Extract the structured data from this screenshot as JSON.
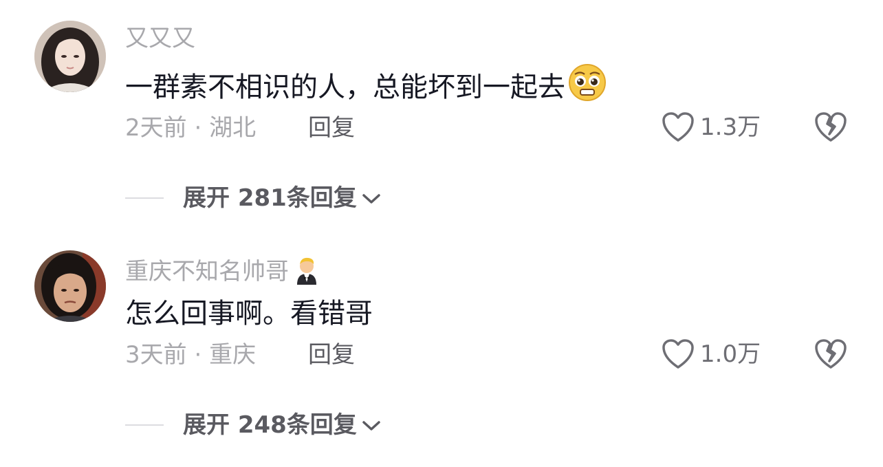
{
  "comments": [
    {
      "username": "又又又",
      "text": "一群素不相识的人，总能坏到一起去",
      "text_emoji": "pleading-face-emoji",
      "time": "2天前",
      "location": "湖北",
      "reply_label": "回复",
      "likes": "1.3万",
      "expand_label": "展开 281条回复"
    },
    {
      "username": "重庆不知名帅哥",
      "username_emoji": "man-in-tuxedo-emoji",
      "text": "怎么回事啊。看错哥",
      "time": "3天前",
      "location": "重庆",
      "reply_label": "回复",
      "likes": "1.0万",
      "expand_label": "展开 248条回复"
    }
  ],
  "separator": " · ",
  "colors": {
    "primary_text": "#161823",
    "secondary_text": "#a8a8ac",
    "action_text": "#5a5a60",
    "background": "#ffffff"
  }
}
